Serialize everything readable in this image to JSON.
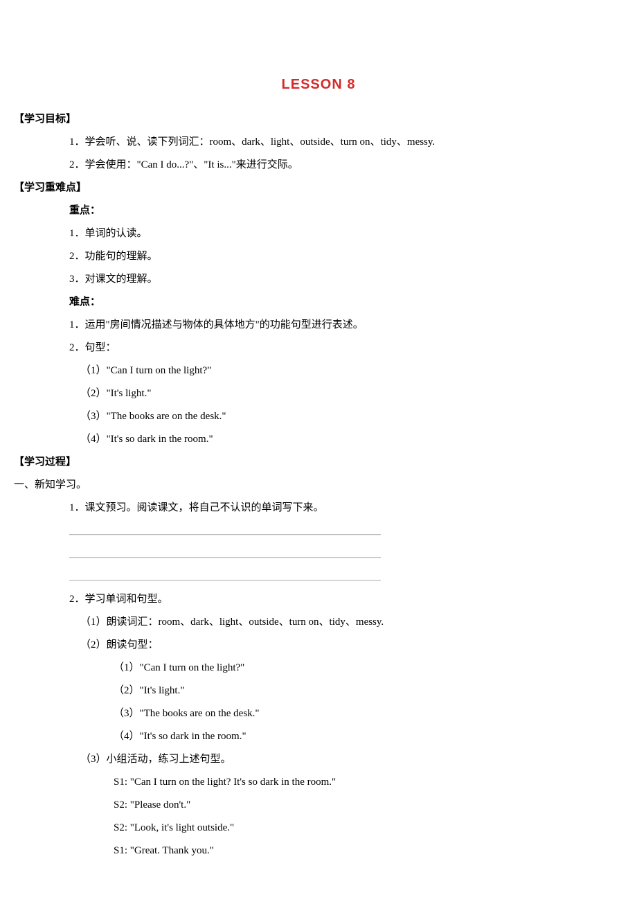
{
  "title": "LESSON 8",
  "sections": {
    "objectives": {
      "heading": "【学习目标】",
      "lines": [
        "1．学会听、说、读下列词汇：room、dark、light、outside、turn on、tidy、messy.",
        "2．学会使用：\"Can I do...?\"、\"It is...\"来进行交际。"
      ]
    },
    "keypoints": {
      "heading": "【学习重难点】",
      "zhong_label": "重点：",
      "zhong_lines": [
        "1．单词的认读。",
        "2．功能句的理解。",
        "3．对课文的理解。"
      ],
      "nan_label": "难点：",
      "nan_lines": [
        "1．运用\"房间情况描述与物体的具体地方\"的功能句型进行表述。",
        "2．句型："
      ],
      "nan_sub": [
        "（1）\"Can I turn on the light?\"",
        "（2）\"It's light.\"",
        "（3）\"The books are on the desk.\"",
        "（4）\"It's so dark in the room.\""
      ]
    },
    "process": {
      "heading": "【学习过程】",
      "top_line": "一、新知学习。",
      "p1": "1．课文预习。阅读课文，将自己不认识的单词写下来。",
      "blank": "＿＿＿＿＿＿＿＿＿＿＿＿＿＿＿＿＿＿＿＿＿＿＿＿＿＿＿＿＿＿",
      "p2": "2．学习单词和句型。",
      "p2_sub1": "（1）朗读词汇：room、dark、light、outside、turn on、tidy、messy.",
      "p2_sub2": "（2）朗读句型：",
      "p2_sub2_lines": [
        "（1）\"Can I turn on the light?\"",
        "（2）\"It's light.\"",
        "（3）\"The books are on the desk.\"",
        "（4）\"It's so dark in the room.\""
      ],
      "p2_sub3": "（3）小组活动，练习上述句型。",
      "p2_sub3_lines": [
        "S1: \"Can I turn on the light? It's so dark in the room.\"",
        "S2: \"Please don't.\"",
        "S2: \"Look, it's light outside.\"",
        "S1: \"Great. Thank you.\""
      ]
    }
  }
}
